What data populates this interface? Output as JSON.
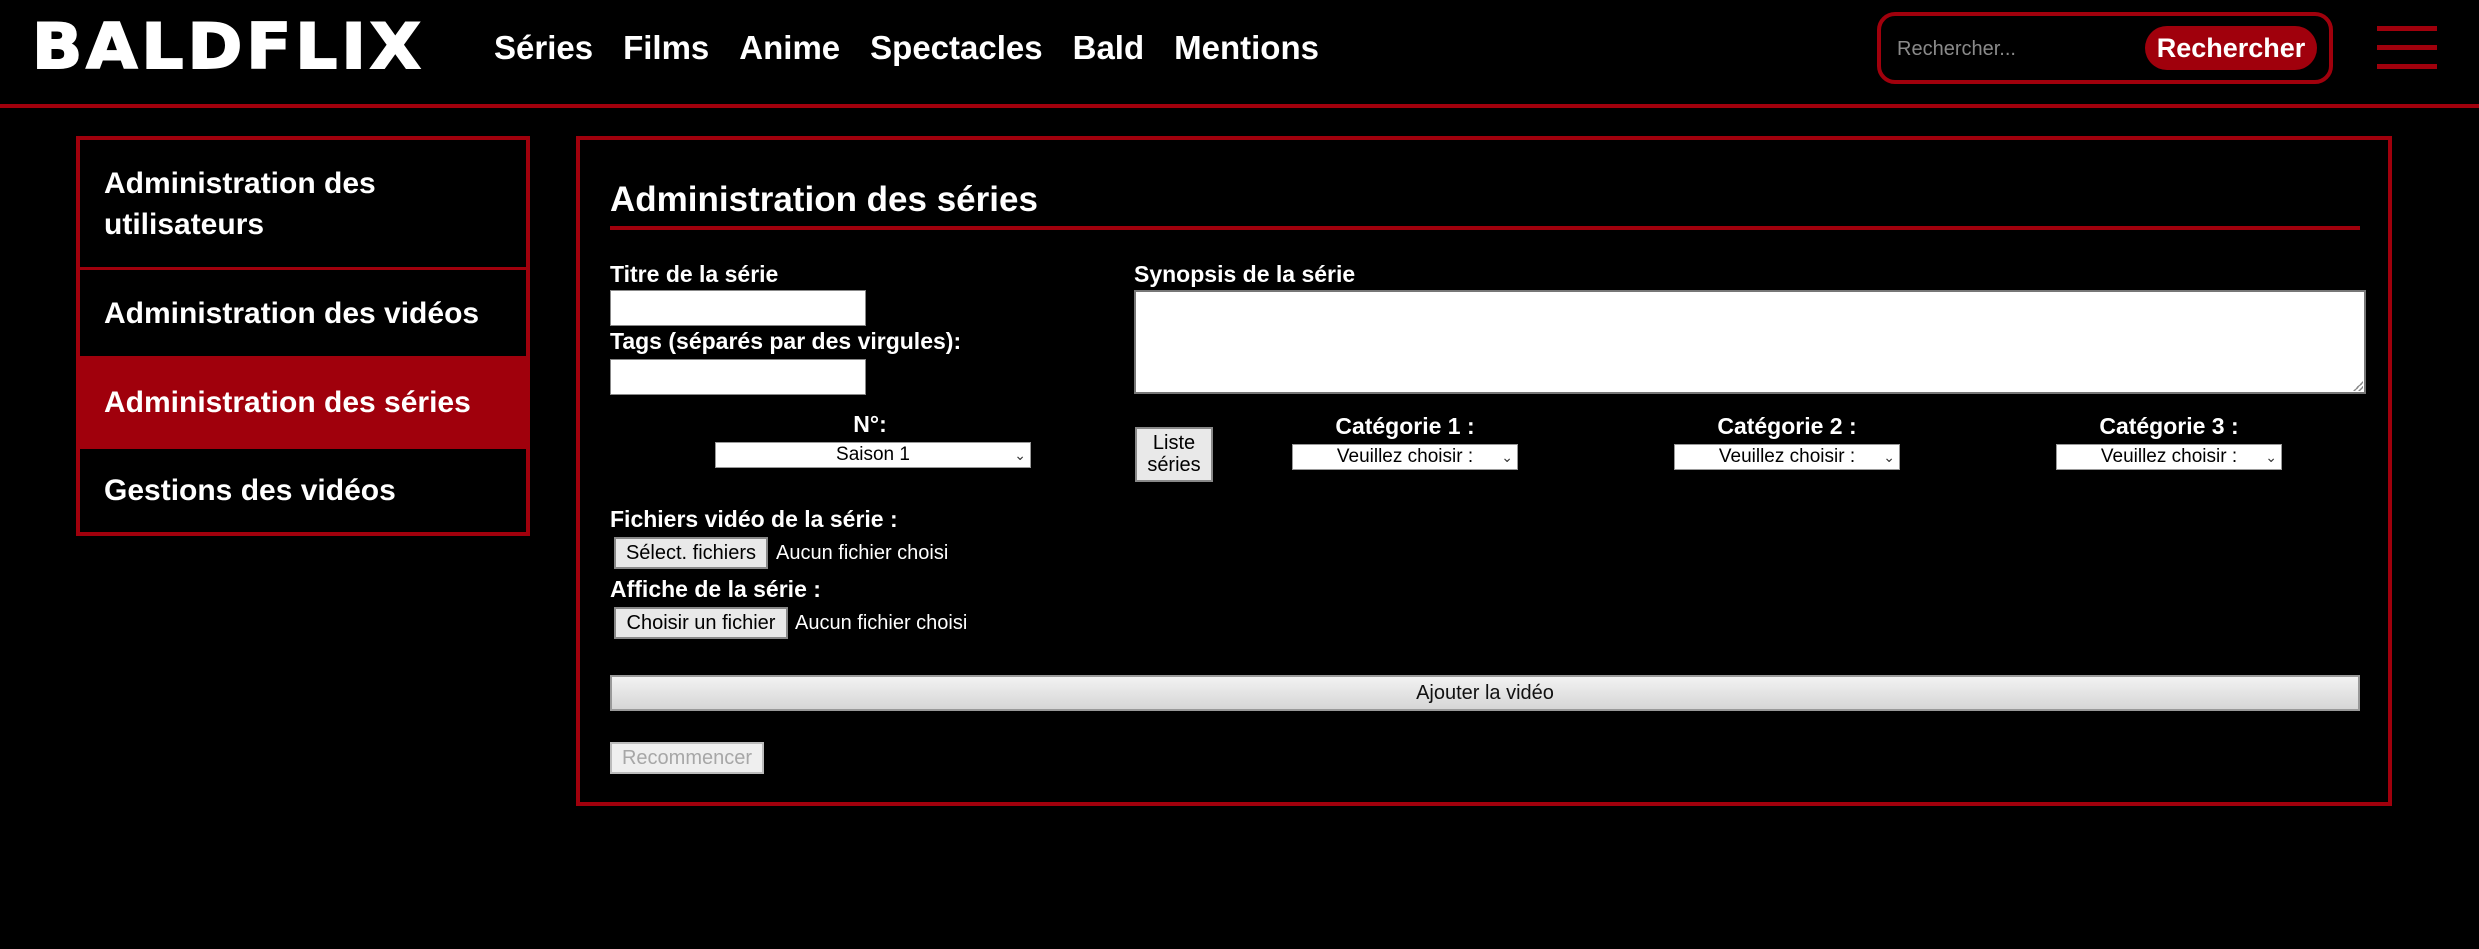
{
  "header": {
    "logo": "BALDFLIX",
    "nav": [
      "Séries",
      "Films",
      "Anime",
      "Spectacles",
      "Bald",
      "Mentions"
    ],
    "search": {
      "placeholder": "Rechercher...",
      "button": "Rechercher"
    }
  },
  "sidebar": {
    "items": [
      {
        "label": "Administration des utilisateurs"
      },
      {
        "label": "Administration des vidéos"
      },
      {
        "label": "Administration des séries",
        "active": true
      },
      {
        "label": "Gestions des vidéos"
      }
    ]
  },
  "form": {
    "title": "Administration des séries",
    "series_title_label": "Titre de la série",
    "series_title_value": "",
    "tags_label": "Tags (séparés par des virgules):",
    "tags_value": "",
    "synopsis_label": "Synopsis de la série",
    "synopsis_value": "",
    "number_label": "N°:",
    "number_selected": "Saison 1",
    "list_button_line1": "Liste",
    "list_button_line2": "séries",
    "categories": [
      {
        "label": "Catégorie 1 :",
        "selected": "Veuillez choisir :"
      },
      {
        "label": "Catégorie 2 :",
        "selected": "Veuillez choisir :"
      },
      {
        "label": "Catégorie 3 :",
        "selected": "Veuillez choisir :"
      }
    ],
    "video_files_label": "Fichiers vidéo de la série :",
    "video_files_button": "Sélect. fichiers",
    "video_files_status": "Aucun fichier choisi",
    "poster_label": "Affiche de la série :",
    "poster_button": "Choisir un fichier",
    "poster_status": "Aucun fichier choisi",
    "submit_button": "Ajouter la vidéo",
    "reset_button": "Recommencer"
  },
  "colors": {
    "accent": "#a0000c",
    "background": "#000000"
  }
}
